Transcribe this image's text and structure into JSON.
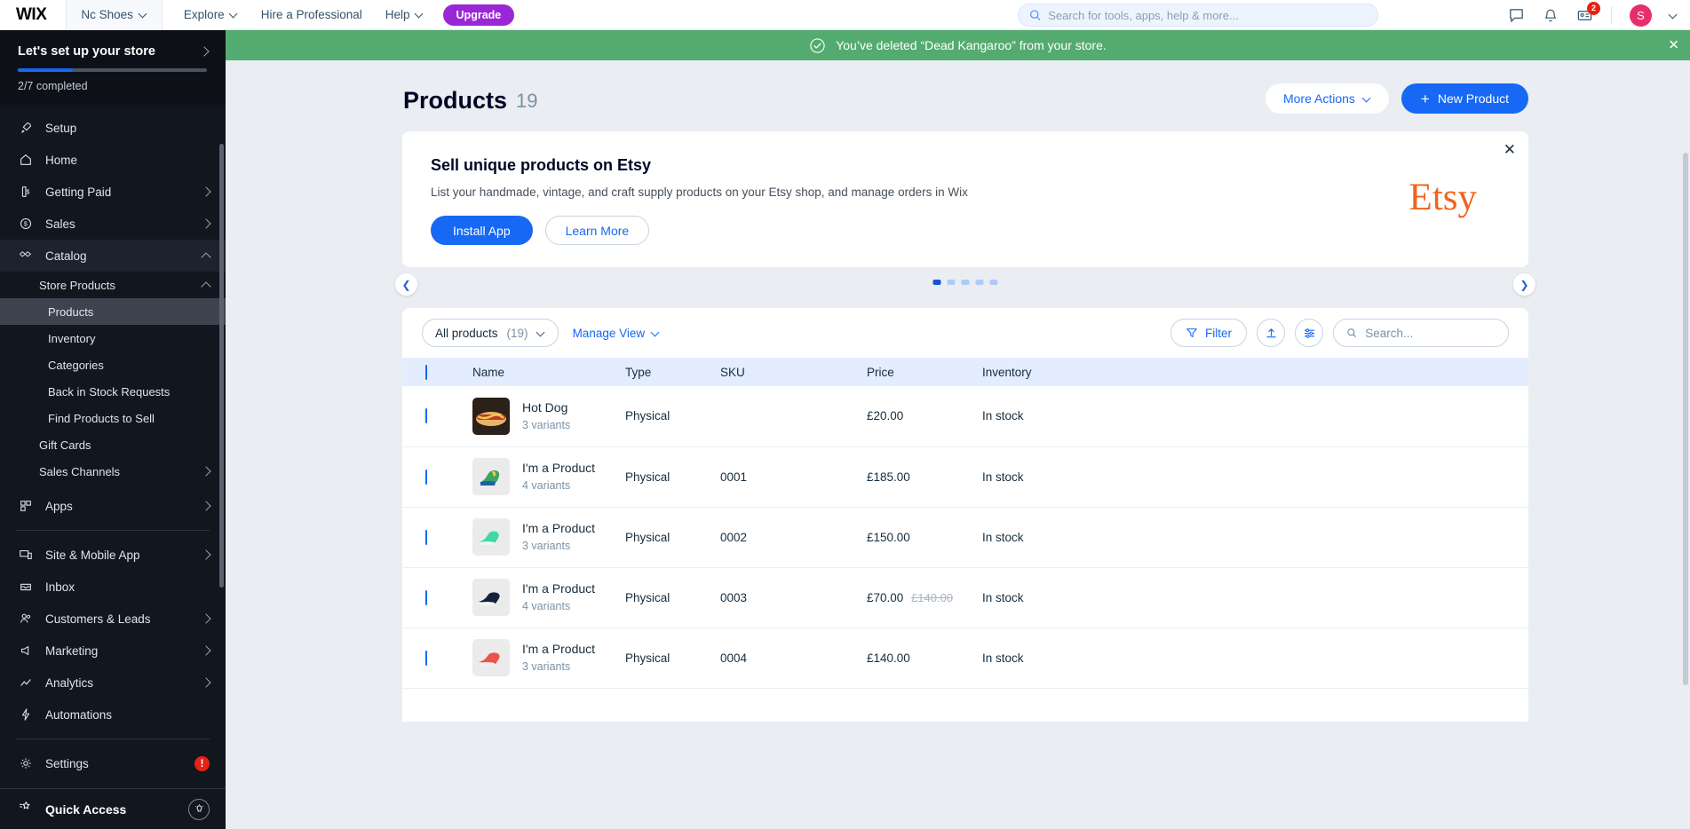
{
  "topbar": {
    "logo": "WIX",
    "site_name": "Nc Shoes",
    "nav": [
      {
        "label": "Explore",
        "has_chevron": true
      },
      {
        "label": "Hire a Professional",
        "has_chevron": false
      },
      {
        "label": "Help",
        "has_chevron": true
      }
    ],
    "upgrade_label": "Upgrade",
    "search_placeholder": "Search for tools, apps, help & more...",
    "search_value": "",
    "icons": [
      "chat-icon",
      "bell-icon",
      "contact-card-icon"
    ],
    "notification_count": "2",
    "avatar_initial": "S"
  },
  "sidebar": {
    "setup": {
      "title": "Let's set up your store",
      "progress_label": "2/7 completed",
      "progress_percent": 29
    },
    "items": [
      {
        "label": "Setup",
        "icon": "rocket-icon",
        "expandable": false
      },
      {
        "label": "Home",
        "icon": "home-icon",
        "expandable": false
      },
      {
        "label": "Getting Paid",
        "icon": "payment-icon",
        "expandable": true
      },
      {
        "label": "Sales",
        "icon": "coin-icon",
        "expandable": true
      },
      {
        "label": "Catalog",
        "icon": "catalog-icon",
        "expandable": true,
        "expanded": true
      }
    ],
    "catalog_children": [
      {
        "label": "Store Products",
        "level": 1,
        "expandable": true,
        "expanded": true
      },
      {
        "label": "Products",
        "level": 2,
        "active": true
      },
      {
        "label": "Inventory",
        "level": 2,
        "active": false
      },
      {
        "label": "Categories",
        "level": 2,
        "active": false
      },
      {
        "label": "Back in Stock Requests",
        "level": 2,
        "active": false
      },
      {
        "label": "Find Products to Sell",
        "level": 2,
        "active": false
      },
      {
        "label": "Gift Cards",
        "level": 1,
        "expandable": false
      },
      {
        "label": "Sales Channels",
        "level": 1,
        "expandable": true
      }
    ],
    "items_after": [
      {
        "label": "Apps",
        "icon": "apps-icon",
        "expandable": true
      }
    ],
    "items_group3": [
      {
        "label": "Site & Mobile App",
        "icon": "devices-icon",
        "expandable": true
      },
      {
        "label": "Inbox",
        "icon": "inbox-icon",
        "expandable": false
      },
      {
        "label": "Customers & Leads",
        "icon": "people-icon",
        "expandable": true
      },
      {
        "label": "Marketing",
        "icon": "megaphone-icon",
        "expandable": true
      },
      {
        "label": "Analytics",
        "icon": "chart-icon",
        "expandable": true
      },
      {
        "label": "Automations",
        "icon": "bolt-icon",
        "expandable": false
      }
    ],
    "settings": {
      "label": "Settings",
      "icon": "gear-icon",
      "alert": "!"
    },
    "quick_access": {
      "label": "Quick Access",
      "icon": "star-icon"
    }
  },
  "banner": {
    "message": "You’ve deleted “Dead Kangaroo” from your store.",
    "icon": "check-circle-icon",
    "color": "#54ab70"
  },
  "page": {
    "title": "Products",
    "count": "19",
    "more_actions": "More Actions",
    "new_product": "New Product"
  },
  "promo": {
    "title": "Sell unique products on Etsy",
    "description": "List your handmade, vintage, and craft supply products on your Etsy shop, and manage orders in Wix",
    "install_label": "Install App",
    "learn_label": "Learn More",
    "brand": "Etsy",
    "brand_color": "#f1641e"
  },
  "carousel": {
    "total_dots": 5,
    "active_index": 0
  },
  "toolbar": {
    "filter_select_label": "All products",
    "filter_select_count": "(19)",
    "manage_view": "Manage View",
    "filter_label": "Filter",
    "export_icon": "upload-icon",
    "columns_icon": "sliders-icon",
    "search_placeholder": "Search...",
    "search_value": ""
  },
  "table": {
    "columns": [
      "Name",
      "Type",
      "SKU",
      "Price",
      "Inventory"
    ],
    "rows": [
      {
        "name": "Hot Dog",
        "variants": "3 variants",
        "type": "Physical",
        "sku": "",
        "price": "£20.00",
        "price_old": "",
        "inventory": "In stock",
        "thumb": "hotdog"
      },
      {
        "name": "I'm a Product",
        "variants": "4 variants",
        "type": "Physical",
        "sku": "0001",
        "price": "£185.00",
        "price_old": "",
        "inventory": "In stock",
        "thumb": "sneaker-green"
      },
      {
        "name": "I'm a Product",
        "variants": "3 variants",
        "type": "Physical",
        "sku": "0002",
        "price": "£150.00",
        "price_old": "",
        "inventory": "In stock",
        "thumb": "sneaker-mint"
      },
      {
        "name": "I'm a Product",
        "variants": "4 variants",
        "type": "Physical",
        "sku": "0003",
        "price": "£70.00",
        "price_old": "£140.00",
        "inventory": "In stock",
        "thumb": "sneaker-navy"
      },
      {
        "name": "I'm a Product",
        "variants": "3 variants",
        "type": "Physical",
        "sku": "0004",
        "price": "£140.00",
        "price_old": "",
        "inventory": "In stock",
        "thumb": "sneaker-red"
      }
    ]
  }
}
